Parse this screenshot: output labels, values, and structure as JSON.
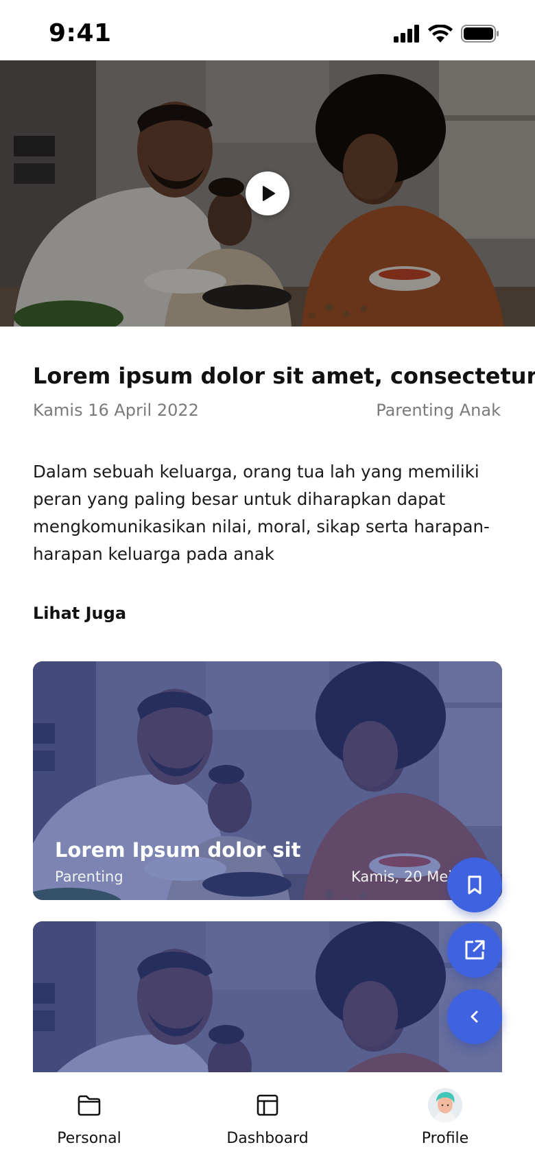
{
  "status_bar": {
    "time": "9:41",
    "icons": [
      "cellular-signal-icon",
      "wifi-icon",
      "battery-icon"
    ]
  },
  "hero": {
    "image": "family-cooking-photo",
    "play_icon": "play-icon"
  },
  "article": {
    "title": "Lorem ipsum dolor sit amet, consectetur",
    "date": "Kamis 16 April 2022",
    "category": "Parenting Anak",
    "body": "Dalam sebuah keluarga, orang tua lah yang memiliki peran yang paling besar untuk diharapkan dapat mengkomunikasikan nilai, moral, sikap serta harapan-harapan keluarga pada anak"
  },
  "see_also": {
    "heading": "Lihat Juga",
    "cards": [
      {
        "title": "Lorem Ipsum dolor sit",
        "category": "Parenting",
        "date": "Kamis, 20 Mei 2022"
      },
      {
        "title": "",
        "category": "",
        "date": ""
      }
    ]
  },
  "fabs": {
    "bookmark": "bookmark-icon",
    "share": "share-icon",
    "back": "chevron-left-icon"
  },
  "nav": {
    "items": [
      {
        "label": "Personal",
        "icon": "folder-icon"
      },
      {
        "label": "Dashboard",
        "icon": "layout-icon"
      },
      {
        "label": "Profile",
        "icon": "avatar"
      }
    ]
  },
  "colors": {
    "accent": "#3f63e0",
    "card_tint": "#2f4296",
    "muted_text": "#7a7a7a"
  }
}
